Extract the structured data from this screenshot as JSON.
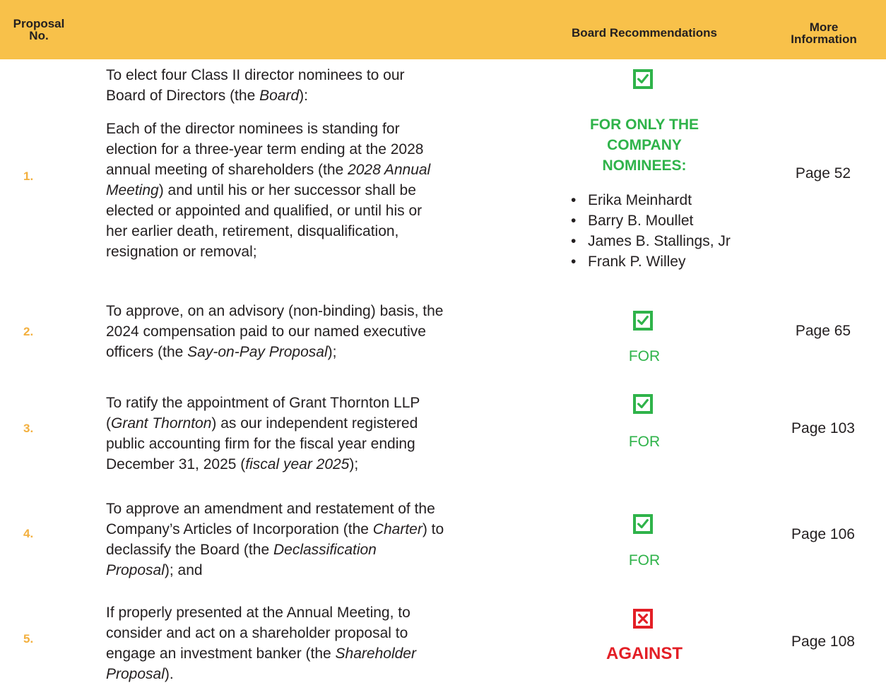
{
  "header": {
    "proposal_no": [
      "Proposal",
      "No."
    ],
    "board_recommendations": "Board Recommendations",
    "more_information": [
      "More",
      "Information"
    ]
  },
  "colors": {
    "header_bg": "#f8c14a",
    "number": "#f3b03f",
    "for_green": "#2fb34a",
    "against_red": "#e31f26"
  },
  "proposals": [
    {
      "number": "1.",
      "description_lines": [
        "To elect four Class II director nominees to our",
        "Board of Directors (the Board):",
        "Each of the director nominees is standing for",
        "election for a three-year term ending at the 2028",
        "annual meeting of shareholders (the 2028 Annual",
        "Meeting) and until his or her successor shall be",
        "elected or appointed and qualified, or until his or",
        "her earlier death, retirement, disqualification,",
        "resignation or removal;"
      ],
      "recommendation": [
        "FOR ONLY THE",
        "COMPANY",
        "NOMINEES:"
      ],
      "recommendation_icon": "check-icon",
      "nominees": [
        "Erika Meinhardt",
        "Barry B. Moullet",
        "James B. Stallings, Jr",
        "Frank P. Willey"
      ],
      "page": "Page 52"
    },
    {
      "number": "2.",
      "description_lines": [
        "To approve, on an advisory (non-binding) basis, the",
        "2024 compensation paid to our named executive",
        "officers (the Say-on-Pay Proposal);"
      ],
      "recommendation": "FOR",
      "recommendation_icon": "check-icon",
      "page": "Page 65"
    },
    {
      "number": "3.",
      "description_lines": [
        "To ratify the appointment of Grant Thornton LLP",
        "(Grant Thornton) as our independent registered",
        "public accounting firm for the fiscal year ending",
        "December 31, 2025 (fiscal year 2025);"
      ],
      "recommendation": "FOR",
      "recommendation_icon": "check-icon",
      "page": "Page 103"
    },
    {
      "number": "4.",
      "description_lines": [
        "To approve an amendment and restatement of the",
        "Company’s Articles of Incorporation (the Charter) to",
        "declassify the Board (the Declassification",
        "Proposal); and"
      ],
      "recommendation": "FOR",
      "recommendation_icon": "check-icon",
      "page": "Page 106"
    },
    {
      "number": "5.",
      "description_lines": [
        "If properly presented at the Annual Meeting, to",
        "consider and act on a shareholder proposal to",
        "engage an investment banker (the Shareholder",
        "Proposal)."
      ],
      "recommendation": "AGAINST",
      "recommendation_icon": "x-icon",
      "page": "Page 108"
    }
  ]
}
